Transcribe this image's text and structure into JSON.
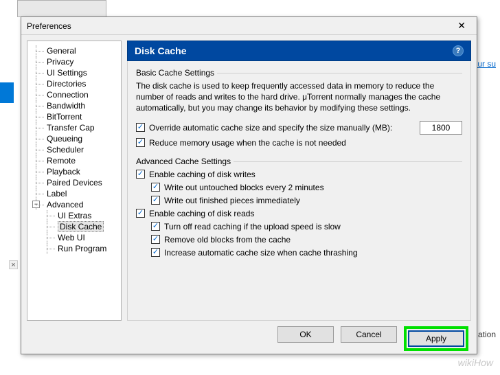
{
  "dialog": {
    "title": "Preferences",
    "close_glyph": "✕"
  },
  "bg": {
    "close_glyph": "×",
    "link": "our su",
    "text": "ation"
  },
  "tree": {
    "items": [
      "General",
      "Privacy",
      "UI Settings",
      "Directories",
      "Connection",
      "Bandwidth",
      "BitTorrent",
      "Transfer Cap",
      "Queueing",
      "Scheduler",
      "Remote",
      "Playback",
      "Paired Devices",
      "Label"
    ],
    "advanced_label": "Advanced",
    "expander_glyph": "−",
    "sub": [
      "UI Extras",
      "Disk Cache",
      "Web UI",
      "Run Program"
    ],
    "selected_sub": 1
  },
  "panel": {
    "header": "Disk Cache",
    "help_glyph": "?",
    "basic_title": "Basic Cache Settings",
    "desc": "The disk cache is used to keep frequently accessed data in memory to reduce the number of reads and writes to the hard drive. μTorrent normally manages the cache automatically, but you may change its behavior by modifying these settings.",
    "override_label": "Override automatic cache size and specify the size manually (MB):",
    "override_value": "1800",
    "reduce_label": "Reduce memory usage when the cache is not needed",
    "adv_title": "Advanced Cache Settings",
    "writes_label": "Enable caching of disk writes",
    "writes_a": "Write out untouched blocks every 2 minutes",
    "writes_b": "Write out finished pieces immediately",
    "reads_label": "Enable caching of disk reads",
    "reads_a": "Turn off read caching if the upload speed is slow",
    "reads_b": "Remove old blocks from the cache",
    "reads_c": "Increase automatic cache size when cache thrashing",
    "check_glyph": "✓"
  },
  "buttons": {
    "ok": "OK",
    "cancel": "Cancel",
    "apply": "Apply"
  },
  "watermark": "wikiHow"
}
